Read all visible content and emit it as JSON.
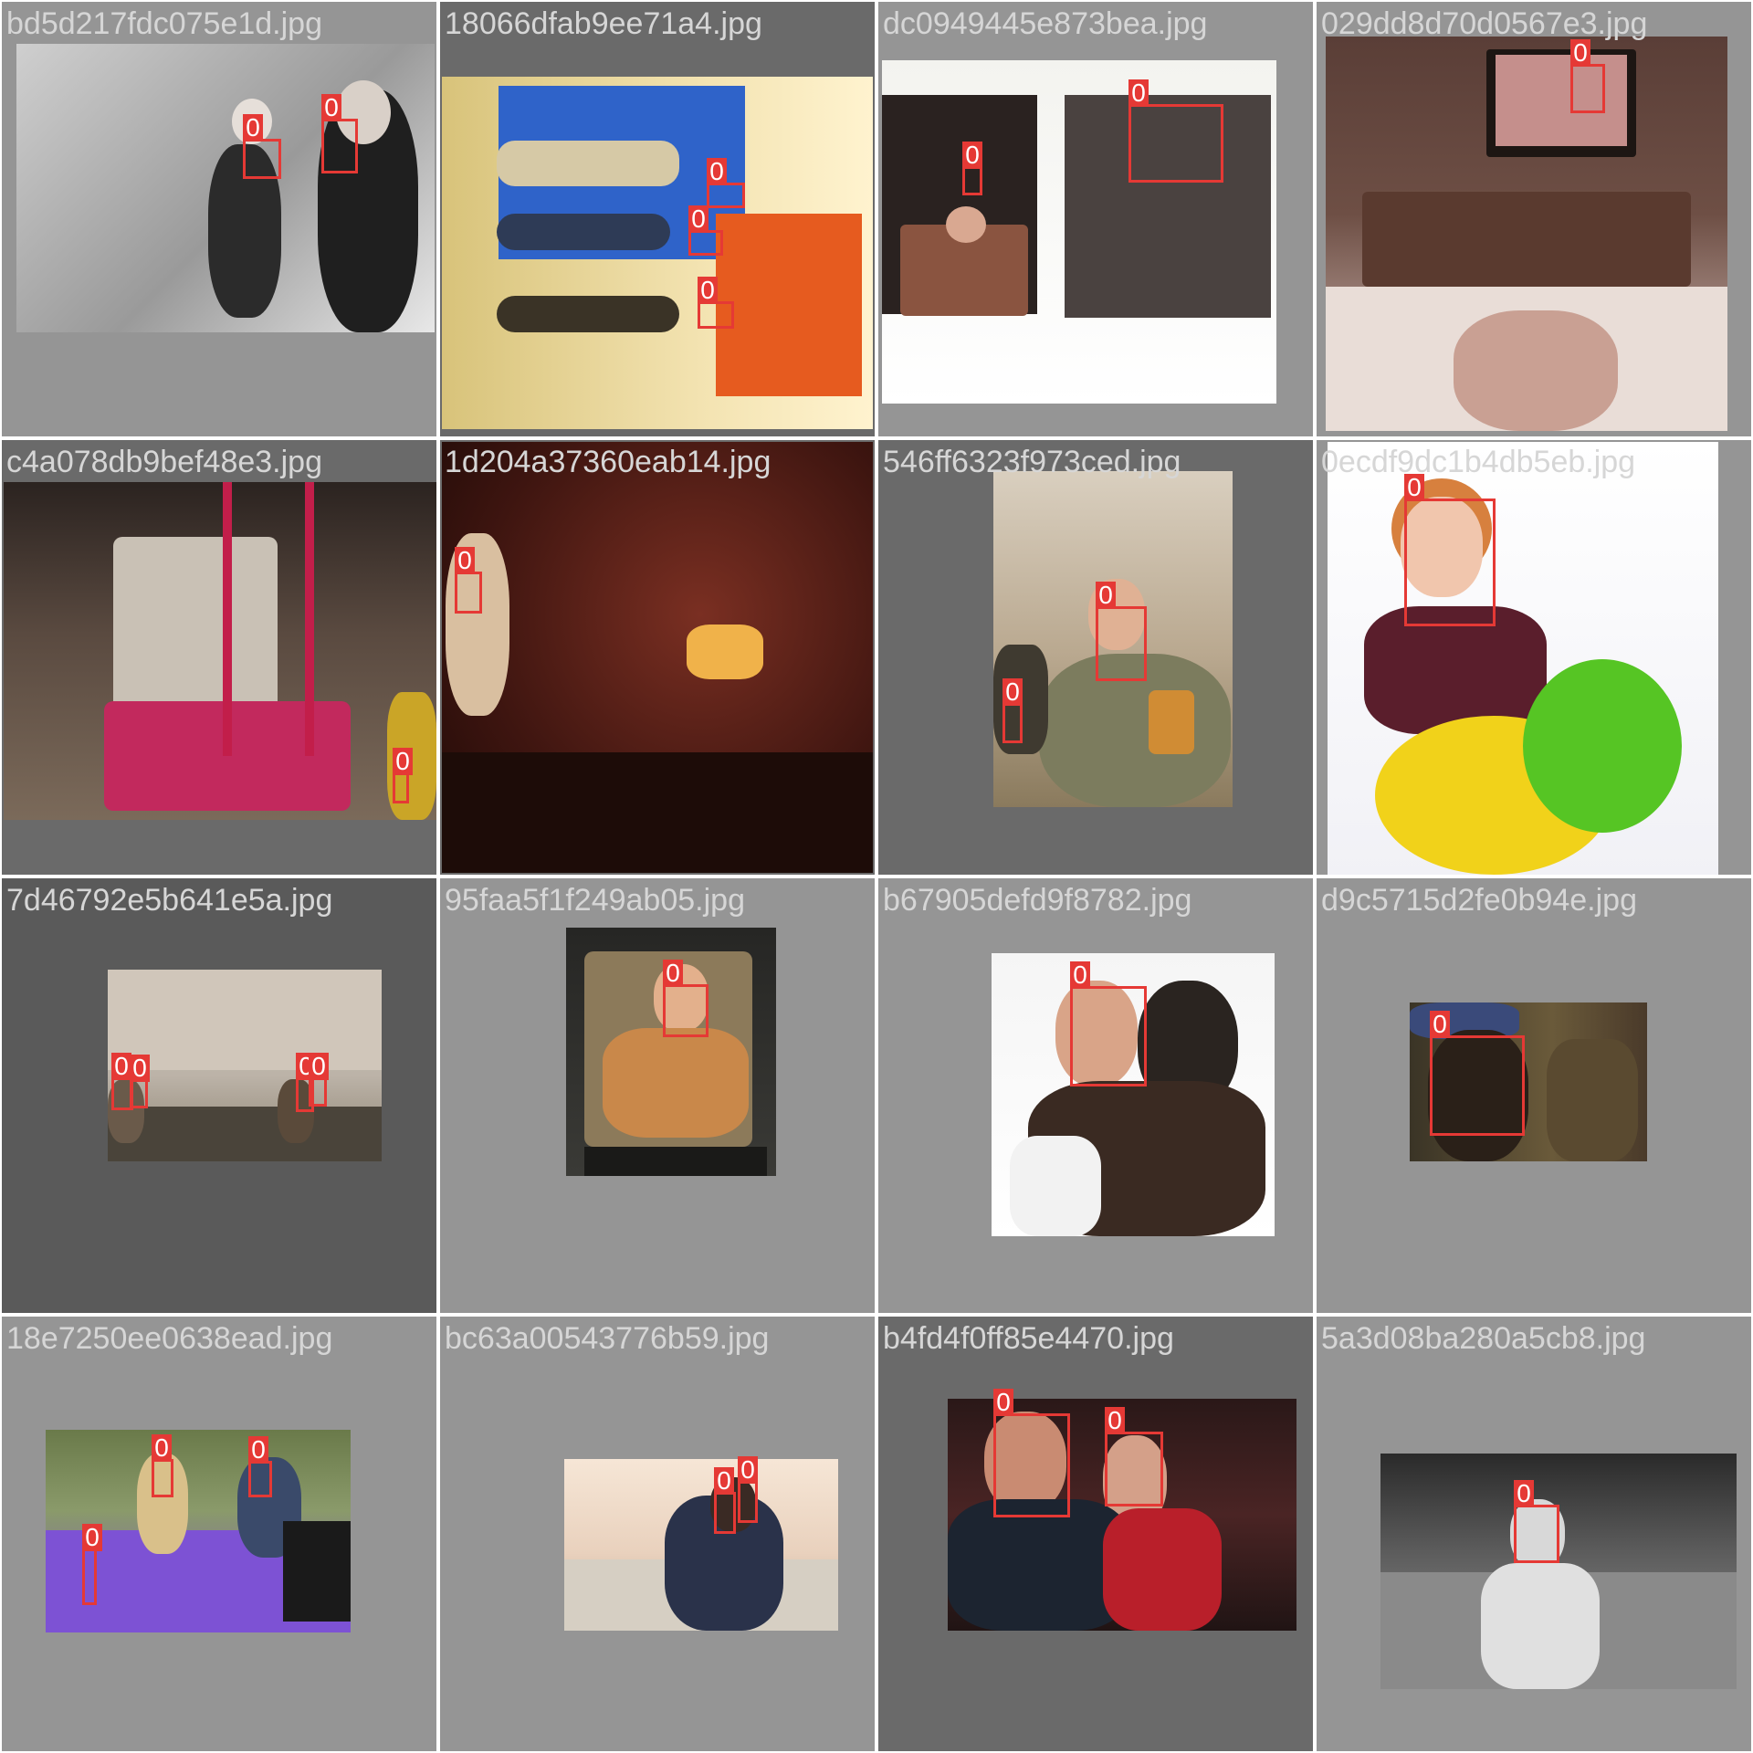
{
  "tiles": [
    {
      "filename": "bd5d217fdc075e1d.jpg",
      "bg": "#959595",
      "boxes": [
        {
          "label": "0"
        },
        {
          "label": "0"
        }
      ]
    },
    {
      "filename": "18066dfab9ee71a4.jpg",
      "bg": "#6a6a6a",
      "boxes": [
        {
          "label": "0"
        },
        {
          "label": "0"
        },
        {
          "label": "0"
        }
      ]
    },
    {
      "filename": "dc0949445e873bea.jpg",
      "bg": "#959595",
      "boxes": [
        {
          "label": "0"
        },
        {
          "label": "0"
        }
      ]
    },
    {
      "filename": "029dd8d70d0567e3.jpg",
      "bg": "#959595",
      "boxes": [
        {
          "label": "0"
        }
      ]
    },
    {
      "filename": "c4a078db9bef48e3.jpg",
      "bg": "#6a6a6a",
      "boxes": [
        {
          "label": "0"
        }
      ]
    },
    {
      "filename": "1d204a37360eab14.jpg",
      "bg": "#6a6a6a",
      "boxes": [
        {
          "label": "0"
        }
      ]
    },
    {
      "filename": "546ff6323f973ced.jpg",
      "bg": "#6a6a6a",
      "boxes": [
        {
          "label": "0"
        },
        {
          "label": "0"
        }
      ]
    },
    {
      "filename": "0ecdf9dc1b4db5eb.jpg",
      "bg": "#959595",
      "boxes": [
        {
          "label": "0"
        }
      ]
    },
    {
      "filename": "7d46792e5b641e5a.jpg",
      "bg": "#5a5a5a",
      "boxes": [
        {
          "label": "0"
        },
        {
          "label": "0"
        },
        {
          "label": "0"
        },
        {
          "label": "0"
        }
      ]
    },
    {
      "filename": "95faa5f1f249ab05.jpg",
      "bg": "#959595",
      "boxes": [
        {
          "label": "0"
        }
      ]
    },
    {
      "filename": "b67905defd9f8782.jpg",
      "bg": "#959595",
      "boxes": [
        {
          "label": "0"
        }
      ]
    },
    {
      "filename": "d9c5715d2fe0b94e.jpg",
      "bg": "#959595",
      "boxes": [
        {
          "label": "0"
        }
      ]
    },
    {
      "filename": "18e7250ee0638ead.jpg",
      "bg": "#959595",
      "boxes": [
        {
          "label": "0"
        },
        {
          "label": "0"
        },
        {
          "label": "0"
        }
      ]
    },
    {
      "filename": "bc63a00543776b59.jpg",
      "bg": "#959595",
      "boxes": [
        {
          "label": "0"
        },
        {
          "label": "0"
        }
      ]
    },
    {
      "filename": "b4fd4f0ff85e4470.jpg",
      "bg": "#6a6a6a",
      "boxes": [
        {
          "label": "0"
        },
        {
          "label": "0"
        }
      ]
    },
    {
      "filename": "5a3d08ba280a5cb8.jpg",
      "bg": "#959595",
      "boxes": [
        {
          "label": "0"
        }
      ]
    }
  ]
}
